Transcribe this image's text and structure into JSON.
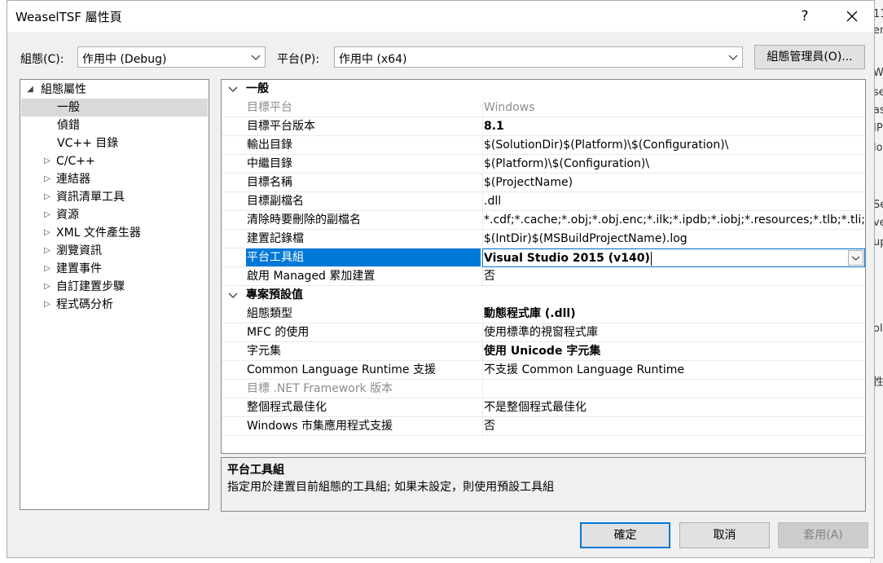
{
  "window": {
    "title": "WeaselTSF 屬性頁",
    "help_btn": "?",
    "close_btn": "✕"
  },
  "config": {
    "label": "組態(C):",
    "value": "作用中 (Debug)",
    "platform_label": "平台(P):",
    "platform_value": "作用中 (x64)",
    "manager_btn": "組態管理員(O)..."
  },
  "tree": {
    "root": "組態屬性",
    "items": [
      {
        "label": "一般",
        "expandable": false,
        "selected": true
      },
      {
        "label": "偵錯",
        "expandable": false
      },
      {
        "label": "VC++ 目錄",
        "expandable": false
      },
      {
        "label": "C/C++",
        "expandable": true
      },
      {
        "label": "連結器",
        "expandable": true
      },
      {
        "label": "資訊清單工具",
        "expandable": true
      },
      {
        "label": "資源",
        "expandable": true
      },
      {
        "label": "XML 文件產生器",
        "expandable": true
      },
      {
        "label": "瀏覽資訊",
        "expandable": true
      },
      {
        "label": "建置事件",
        "expandable": true
      },
      {
        "label": "自訂建置步驟",
        "expandable": true
      },
      {
        "label": "程式碼分析",
        "expandable": true
      }
    ]
  },
  "grid": {
    "sections": [
      {
        "title": "一般",
        "rows": [
          {
            "name": "目標平台",
            "value": "Windows",
            "dim": true
          },
          {
            "name": "目標平台版本",
            "value": "8.1",
            "bold": true
          },
          {
            "name": "輸出目錄",
            "value": "$(SolutionDir)$(Platform)\\$(Configuration)\\"
          },
          {
            "name": "中繼目錄",
            "value": "$(Platform)\\$(Configuration)\\"
          },
          {
            "name": "目標名稱",
            "value": "$(ProjectName)"
          },
          {
            "name": "目標副檔名",
            "value": ".dll"
          },
          {
            "name": "清除時要刪除的副檔名",
            "value": "*.cdf;*.cache;*.obj;*.obj.enc;*.ilk;*.ipdb;*.iobj;*.resources;*.tlb;*.tli;*.tlh;*"
          },
          {
            "name": "建置記錄檔",
            "value": "$(IntDir)$(MSBuildProjectName).log"
          },
          {
            "name": "平台工具組",
            "value": "Visual Studio 2015 (v140)",
            "bold": true,
            "selected": true
          },
          {
            "name": "啟用 Managed 累加建置",
            "value": "否"
          }
        ]
      },
      {
        "title": "專案預設值",
        "rows": [
          {
            "name": "組態類型",
            "value": "動態程式庫 (.dll)",
            "bold": true
          },
          {
            "name": "MFC 的使用",
            "value": "使用標準的視窗程式庫"
          },
          {
            "name": "字元集",
            "value": "使用 Unicode 字元集",
            "bold": true
          },
          {
            "name": "Common Language Runtime 支援",
            "value": "不支援 Common Language Runtime"
          },
          {
            "name": "目標 .NET Framework 版本",
            "value": "",
            "dim": true
          },
          {
            "name": "整個程式最佳化",
            "value": "不是整個程式最佳化"
          },
          {
            "name": "Windows 市集應用程式支援",
            "value": "否"
          }
        ]
      }
    ]
  },
  "description": {
    "title": "平台工具組",
    "text": "指定用於建置目前組態的工具組; 如果未設定，則使用預設工具組"
  },
  "buttons": {
    "ok": "確定",
    "cancel": "取消",
    "apply": "套用(A)"
  },
  "background": [
    "11",
    "en",
    "W",
    "se",
    "as",
    "IP",
    "lo",
    "Se",
    "ve",
    "up",
    "ol",
    "性"
  ],
  "colors": {
    "accent": "#0078d7",
    "dialog_bg": "#f0f0f0",
    "selection_bg": "#d9d9d9"
  }
}
